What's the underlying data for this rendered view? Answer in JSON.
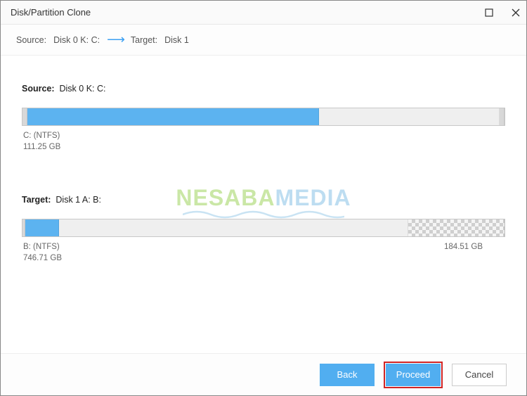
{
  "titlebar": {
    "title": "Disk/Partition Clone"
  },
  "breadcrumb": {
    "source_label": "Source:",
    "source_value": "Disk 0 K: C:",
    "target_label": "Target:",
    "target_value": "Disk 1"
  },
  "source": {
    "label": "Source:",
    "value": "Disk 0 K: C:",
    "partition_name": "C: (NTFS)",
    "partition_size": "111.25 GB",
    "segments": [
      {
        "type": "tiny",
        "width_pct": 1
      },
      {
        "type": "blue",
        "width_pct": 60.5
      },
      {
        "type": "grey",
        "width_pct": 37.5
      },
      {
        "type": "tiny",
        "width_pct": 1
      }
    ]
  },
  "target": {
    "label": "Target:",
    "value": "Disk 1 A: B:",
    "partition_name": "B: (NTFS)",
    "partition_size": "746.71 GB",
    "unallocated_size": "184.51 GB",
    "segments": [
      {
        "type": "tiny",
        "width_pct": 0.6
      },
      {
        "type": "blue",
        "width_pct": 7
      },
      {
        "type": "grey",
        "width_pct": 72.4
      },
      {
        "type": "checker",
        "width_pct": 20
      }
    ]
  },
  "watermark": {
    "part1": "NESABA",
    "part2": "MEDIA"
  },
  "footer": {
    "back": "Back",
    "proceed": "Proceed",
    "cancel": "Cancel"
  }
}
